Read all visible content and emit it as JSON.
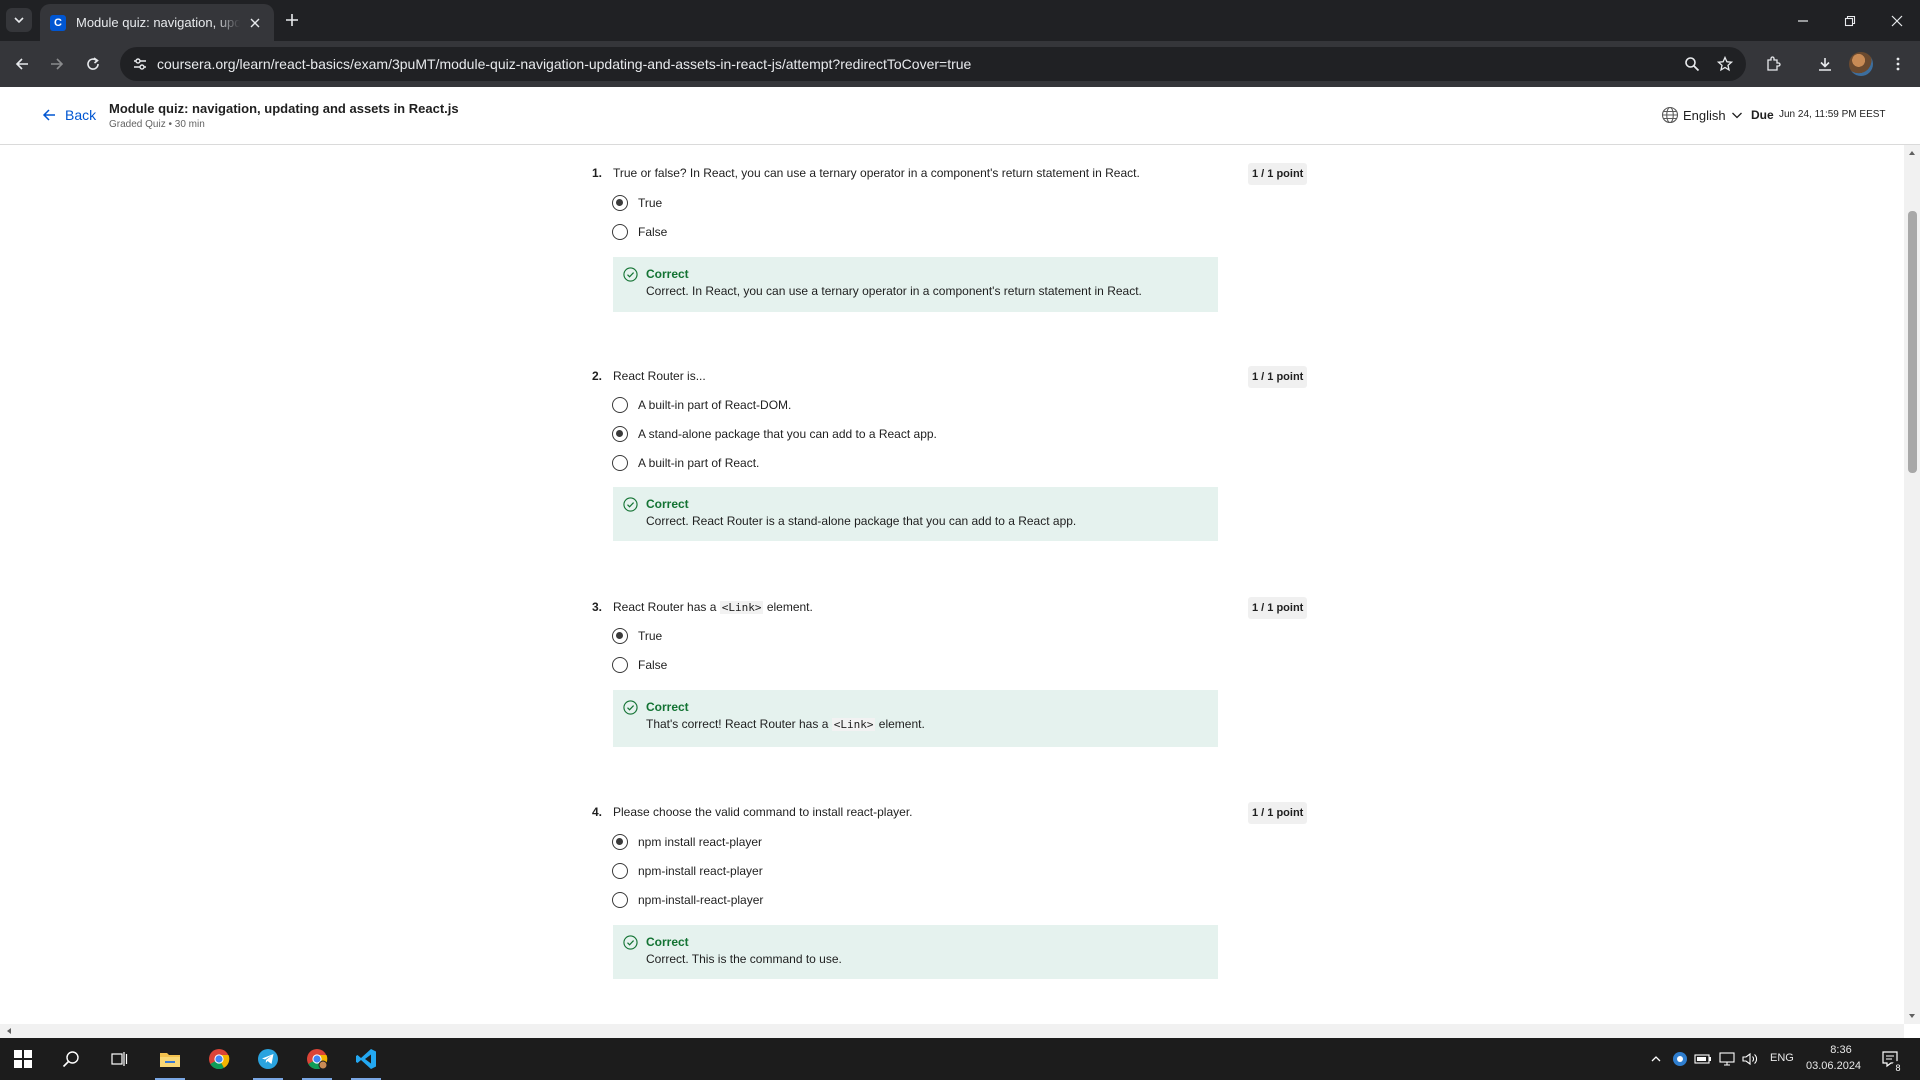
{
  "browser": {
    "tab_title": "Module quiz: navigation, updating and assets in React.js",
    "favicon_letter": "C",
    "url": "coursera.org/learn/react-basics/exam/3puMT/module-quiz-navigation-updating-and-assets-in-react-js/attempt?redirectToCover=true"
  },
  "header": {
    "back_label": "Back",
    "quiz_title": "Module quiz: navigation, updating and assets in React.js",
    "quiz_subtitle": "Graded Quiz • 30 min",
    "language": "English",
    "due_label": "Due",
    "due_value": "Jun 24, 11:59 PM EEST"
  },
  "questions": [
    {
      "number": "1.",
      "text": "True or false? In React, you can use a ternary operator in a component's return statement in React.",
      "points": "1 / 1 point",
      "options": [
        {
          "label": "True",
          "selected": true
        },
        {
          "label": "False",
          "selected": false
        }
      ],
      "feedback_title": "Correct",
      "feedback_text": "Correct. In React, you can use a ternary operator in a component's return statement in React."
    },
    {
      "number": "2.",
      "text": "React Router is...",
      "points": "1 / 1 point",
      "options": [
        {
          "label": "A built-in part of React-DOM.",
          "selected": false
        },
        {
          "label": "A stand-alone package that you can add to a React app.",
          "selected": true
        },
        {
          "label": "A built-in part of React.",
          "selected": false
        }
      ],
      "feedback_title": "Correct",
      "feedback_text": "Correct. React Router is a stand-alone package that you can add to a React app."
    },
    {
      "number": "3.",
      "text_before": "React Router has a ",
      "text_code": "<Link>",
      "text_after": " element.",
      "points": "1 / 1 point",
      "options": [
        {
          "label": "True",
          "selected": true
        },
        {
          "label": "False",
          "selected": false
        }
      ],
      "feedback_title": "Correct",
      "feedback_before": "That's correct! React Router has a ",
      "feedback_code": "<Link>",
      "feedback_after": " element."
    },
    {
      "number": "4.",
      "text": "Please choose the valid command to install react-player.",
      "points": "1 / 1 point",
      "options": [
        {
          "label": "npm install react-player",
          "selected": true
        },
        {
          "label": "npm-install react-player",
          "selected": false
        },
        {
          "label": "npm-install-react-player",
          "selected": false
        }
      ],
      "feedback_title": "Correct",
      "feedback_text": "Correct. This is the command to use."
    }
  ],
  "taskbar": {
    "language": "ENG",
    "time": "8:36",
    "date": "03.06.2024",
    "notification_count": "8"
  },
  "colors": {
    "link": "#0056d2",
    "correct_bg": "#e5f2ee",
    "correct_text": "#137333"
  }
}
